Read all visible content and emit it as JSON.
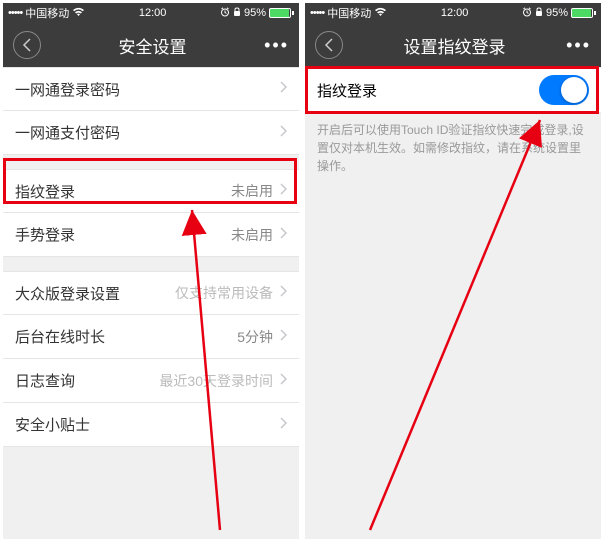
{
  "status": {
    "carrier": "中国移动",
    "time": "12:00",
    "battery": "95%"
  },
  "left": {
    "title": "安全设置",
    "groups": [
      [
        {
          "label": "一网通登录密码",
          "value": "",
          "light": false
        },
        {
          "label": "一网通支付密码",
          "value": "",
          "light": false
        }
      ],
      [
        {
          "label": "指纹登录",
          "value": "未启用",
          "light": false
        },
        {
          "label": "手势登录",
          "value": "未启用",
          "light": false
        }
      ],
      [
        {
          "label": "大众版登录设置",
          "value": "仅支持常用设备",
          "light": true
        },
        {
          "label": "后台在线时长",
          "value": "5分钟",
          "light": false
        },
        {
          "label": "日志查询",
          "value": "最近30天登录时间",
          "light": true
        },
        {
          "label": "安全小贴士",
          "value": "",
          "light": false
        }
      ]
    ]
  },
  "right": {
    "title": "设置指纹登录",
    "switch_label": "指纹登录",
    "hint": "开启后可以使用Touch ID验证指纹快速完成登录,设置仅对本机生效。如需修改指纹，请在系统设置里操作。"
  },
  "colors": {
    "highlight": "#e60012",
    "switch_on": "#007aff"
  }
}
